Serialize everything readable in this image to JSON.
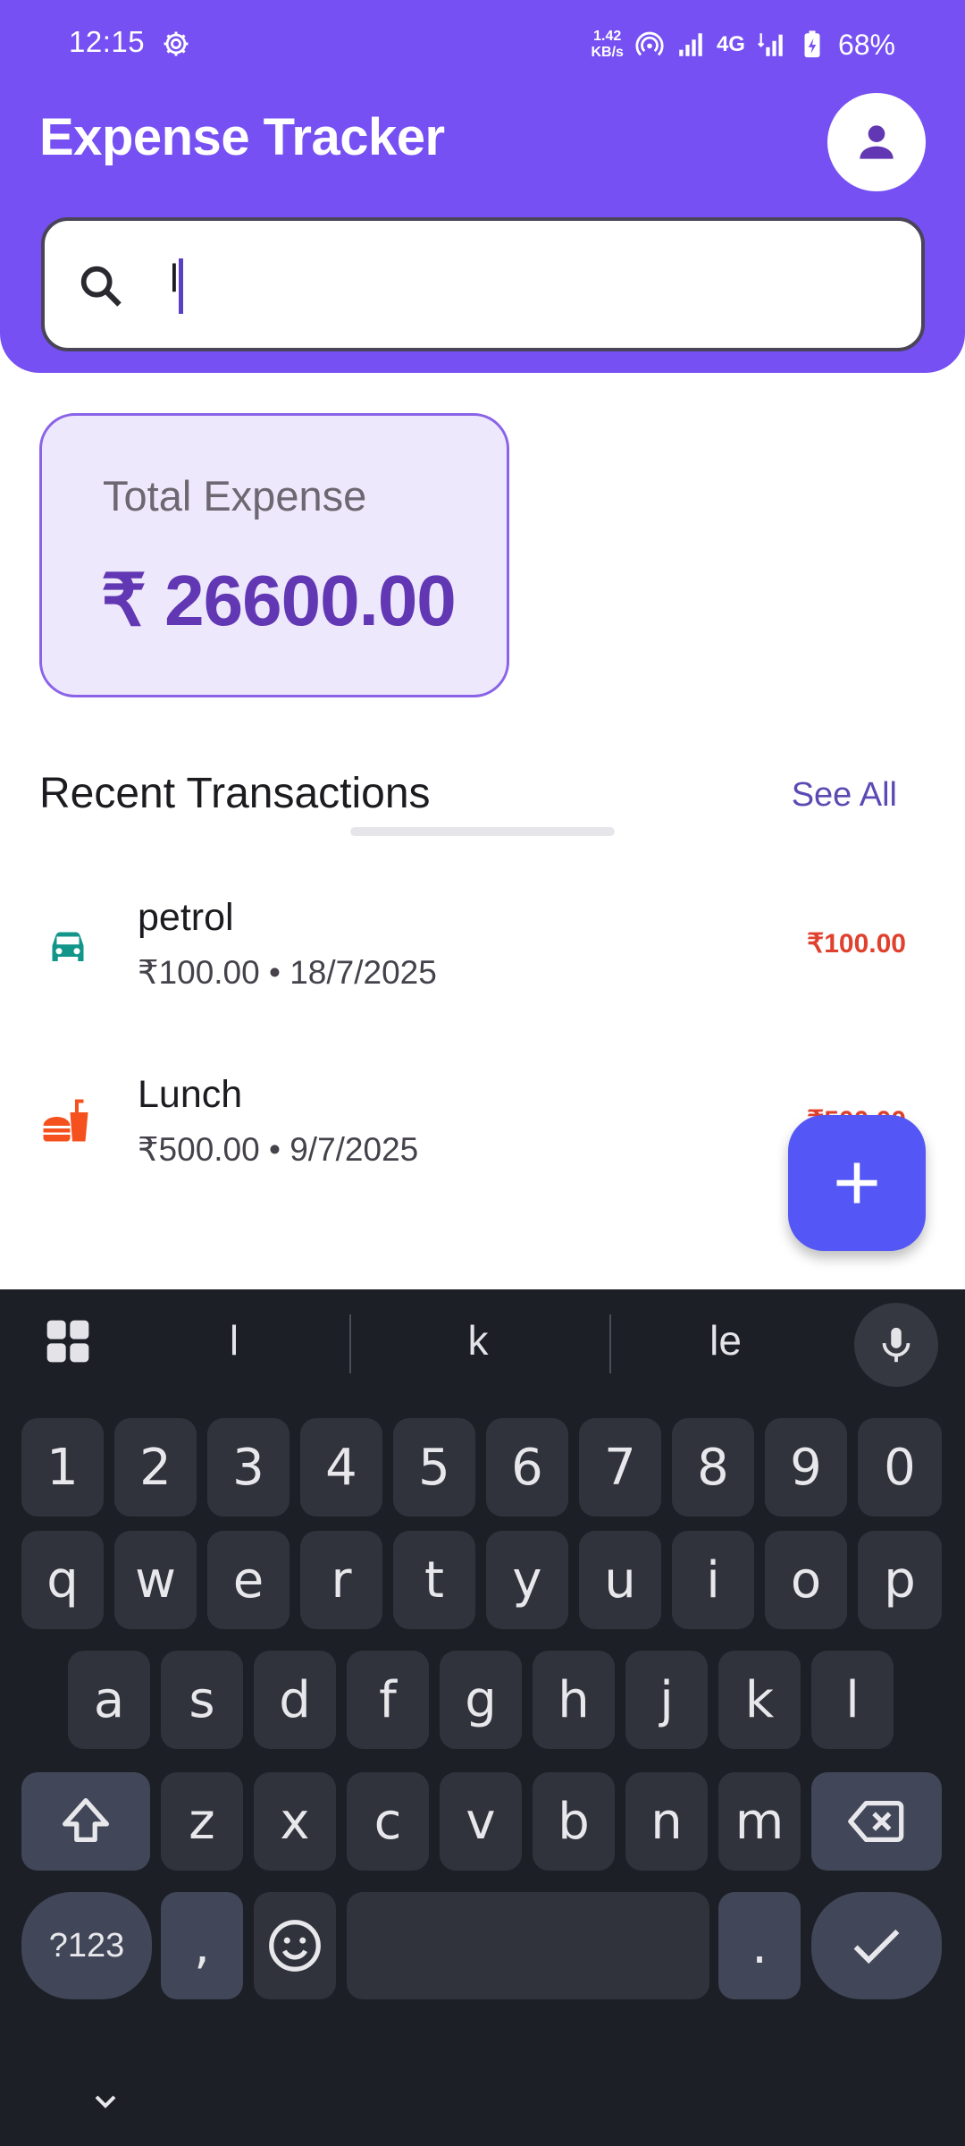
{
  "status_bar": {
    "time": "12:15",
    "net_speed_value": "1.42",
    "net_speed_unit": "KB/s",
    "network": "4G",
    "battery": "68%"
  },
  "header": {
    "title": "Expense Tracker"
  },
  "search": {
    "value": "l"
  },
  "summary": {
    "label": "Total Expense",
    "value": "₹ 26600.00"
  },
  "recent": {
    "title": "Recent Transactions",
    "see_all": "See All",
    "items": [
      {
        "name": "petrol",
        "detail": "₹100.00 • 18/7/2025",
        "amount": "₹100.00",
        "icon": "car-icon",
        "icon_color": "#13968a"
      },
      {
        "name": "Lunch",
        "detail": "₹500.00 • 9/7/2025",
        "amount": "₹500.00",
        "icon": "fastfood-icon",
        "icon_color": "#f4511e"
      }
    ]
  },
  "fab": {
    "icon": "add-icon"
  },
  "keyboard": {
    "suggestions": [
      "l",
      "k",
      "le"
    ],
    "row_numbers": [
      "1",
      "2",
      "3",
      "4",
      "5",
      "6",
      "7",
      "8",
      "9",
      "0"
    ],
    "row1": [
      "q",
      "w",
      "e",
      "r",
      "t",
      "y",
      "u",
      "i",
      "o",
      "p"
    ],
    "row2": [
      "a",
      "s",
      "d",
      "f",
      "g",
      "h",
      "j",
      "k",
      "l"
    ],
    "row3": [
      "z",
      "x",
      "c",
      "v",
      "b",
      "n",
      "m"
    ],
    "symbols_key": "?123",
    "comma_key": ",",
    "period_key": "."
  },
  "colors": {
    "primary": "#7650f2",
    "card_bg": "#eee8fc",
    "total_text": "#6237b3",
    "expense_red": "#e0412e",
    "fab": "#5457f5",
    "keyboard_bg": "#1c1f26"
  }
}
